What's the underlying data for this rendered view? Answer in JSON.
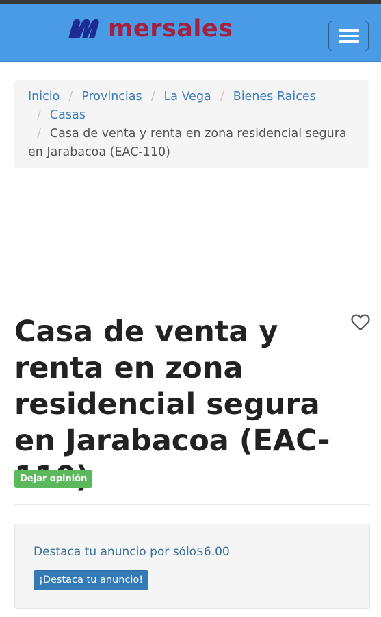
{
  "header": {
    "brand": "mersales",
    "menu_label": "menu"
  },
  "breadcrumb": {
    "items": [
      "Inicio",
      "Provincias",
      "La Vega",
      "Bienes Raices",
      "Casas"
    ],
    "separator": "/",
    "current": "Casa de venta y renta en zona residencial segura en Jarabacoa (EAC-110)"
  },
  "listing": {
    "title": "Casa de venta y renta en zona residencial segura en Jarabacoa (EAC-110)",
    "opinion_label": "Dejar opinión",
    "favorite_icon": "heart-outline-icon"
  },
  "promo": {
    "text": "Destaca tu anuncio por sólo$6.00",
    "button_label": "¡Destaca tu anuncio!"
  },
  "colors": {
    "header_bg": "#4a9be6",
    "brand_red": "#a3203f",
    "logo_mark": "#1d2a8f",
    "link": "#3a7bbd",
    "success": "#5cb85c",
    "primary": "#337ab7"
  }
}
